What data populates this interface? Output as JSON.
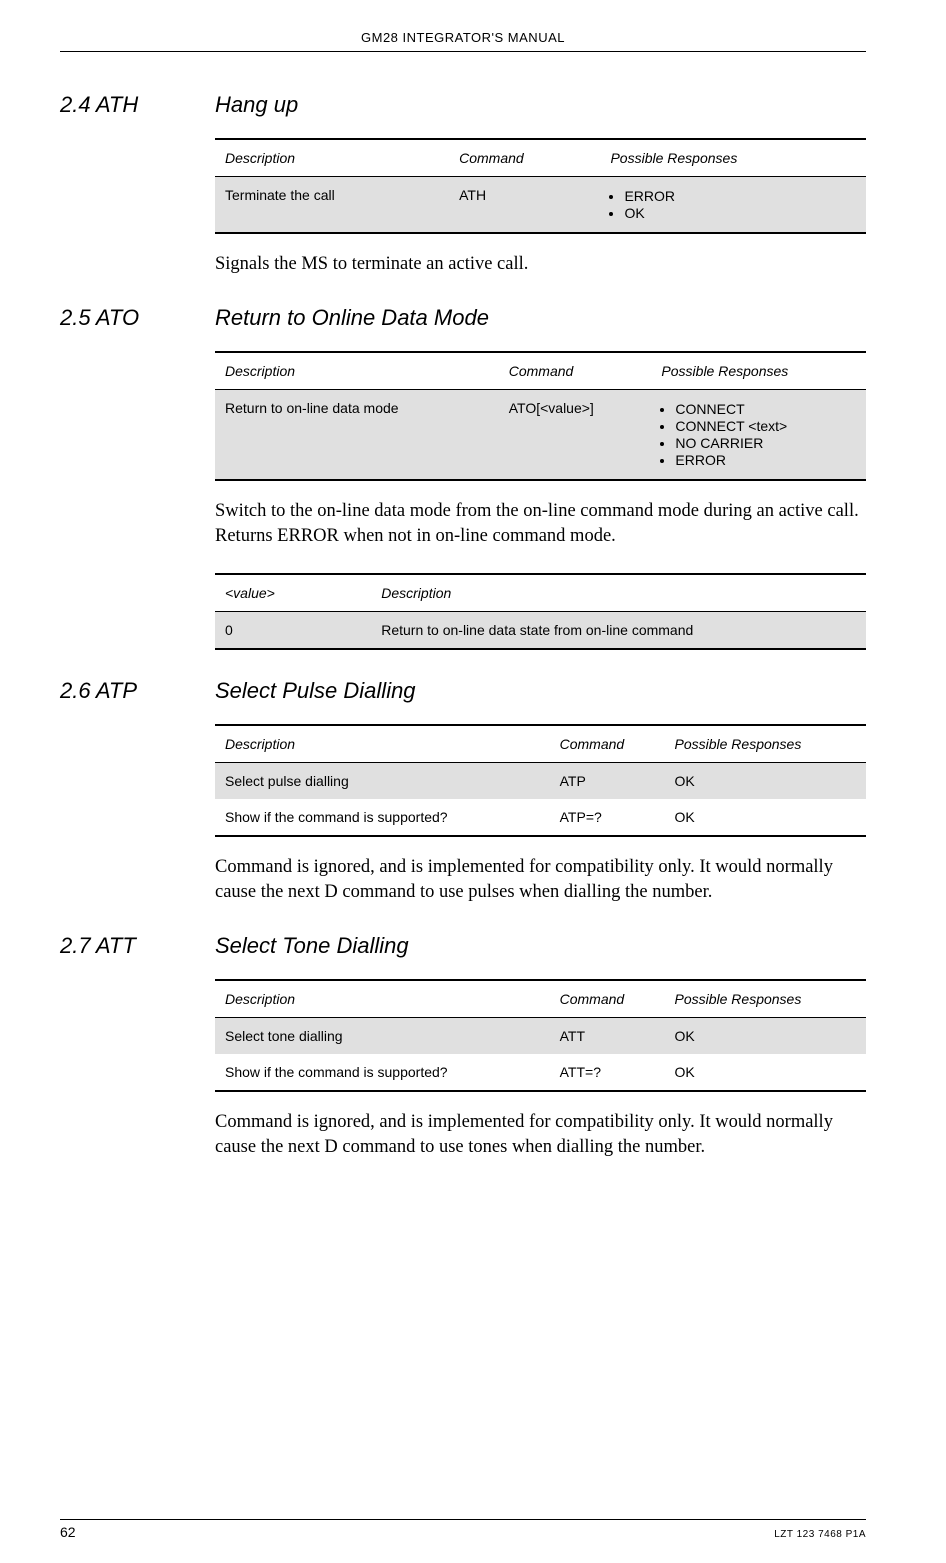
{
  "header": "GM28 INTEGRATOR'S MANUAL",
  "sections": [
    {
      "num": "2.4 ATH",
      "title": "Hang up",
      "table_headers": [
        "Description",
        "Command",
        "Possible Responses"
      ],
      "rows": [
        {
          "desc": "Terminate the call",
          "cmd": "ATH",
          "resp": [
            "ERROR",
            "OK"
          ]
        }
      ],
      "para": "Signals the MS to terminate an active call."
    },
    {
      "num": "2.5 ATO",
      "title": "Return to Online Data Mode",
      "table_headers": [
        "Description",
        "Command",
        "Possible Responses"
      ],
      "rows": [
        {
          "desc": "Return to on-line data mode",
          "cmd": "ATO[<value>]",
          "resp": [
            "CONNECT",
            "CONNECT <text>",
            "NO CARRIER",
            "ERROR"
          ]
        }
      ],
      "para": "Switch to the on-line data mode from the on-line command mode during an active call. Returns ERROR when not in on-line command mode.",
      "value_headers": [
        "<value>",
        "Description"
      ],
      "value_rows": [
        {
          "v": "0",
          "d": "Return to on-line data state from on-line command"
        }
      ]
    },
    {
      "num": "2.6 ATP",
      "title": "Select Pulse Dialling",
      "table_headers": [
        "Description",
        "Command",
        "Possible Responses"
      ],
      "rows": [
        {
          "desc": "Select pulse dialling",
          "cmd": "ATP",
          "resp_text": "OK"
        },
        {
          "desc": "Show if the command is supported?",
          "cmd": "ATP=?",
          "resp_text": "OK"
        }
      ],
      "para": "Command is ignored, and is implemented for compatibility only. It would normally cause the next D command to use pulses when dialling the number."
    },
    {
      "num": "2.7 ATT",
      "title": "Select Tone Dialling",
      "table_headers": [
        "Description",
        "Command",
        "Possible Responses"
      ],
      "rows": [
        {
          "desc": "Select tone dialling",
          "cmd": "ATT",
          "resp_text": "OK"
        },
        {
          "desc": "Show if the command is supported?",
          "cmd": "ATT=?",
          "resp_text": "OK"
        }
      ],
      "para": "Command is ignored, and is implemented for compatibility only. It would normally cause the next D command to use tones when dialling the number."
    }
  ],
  "footer": {
    "page": "62",
    "docnum": "LZT 123 7468 P1A"
  }
}
